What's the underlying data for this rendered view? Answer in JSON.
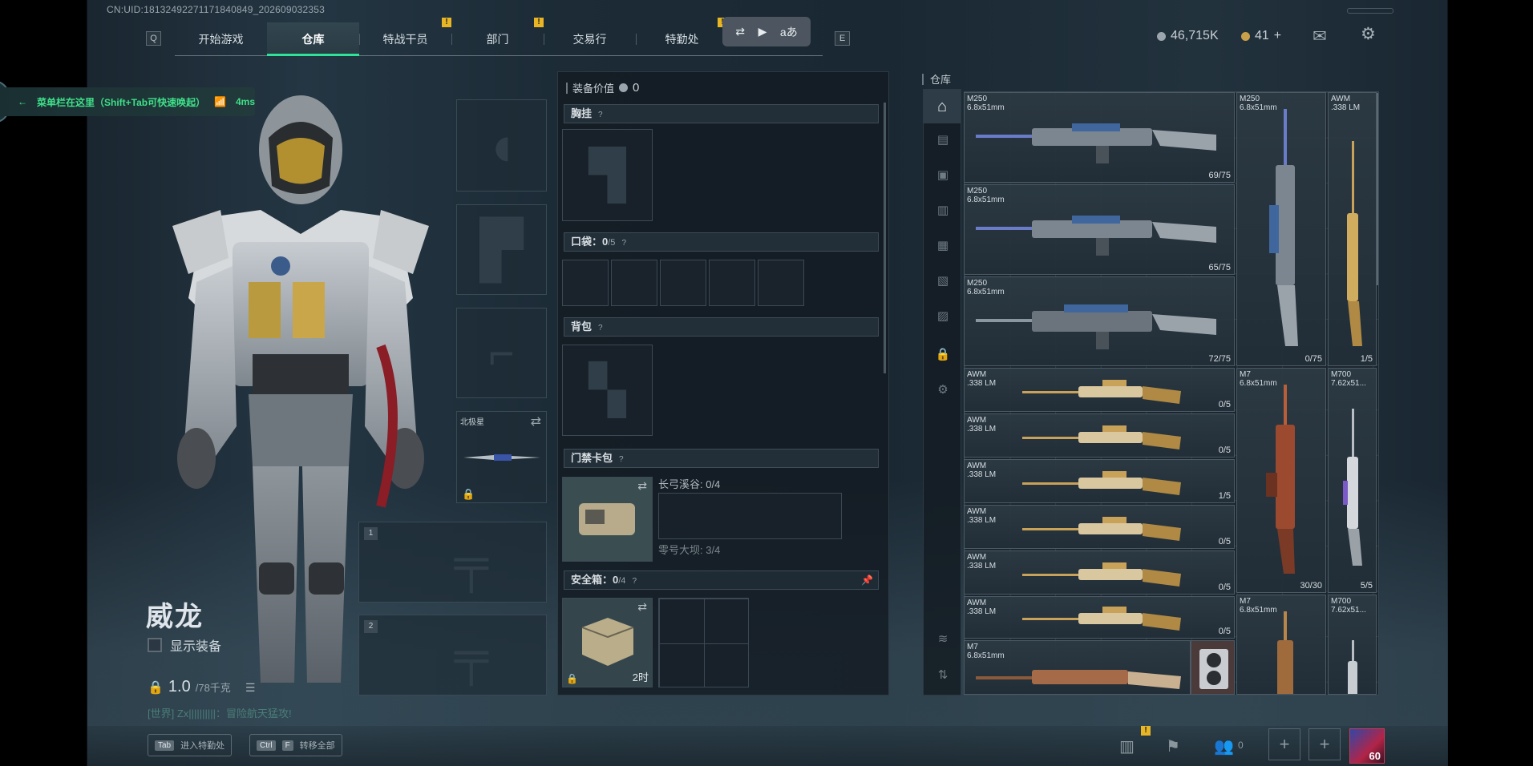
{
  "uid": "CN:UID:1813249227117184084​9_202609032353",
  "nav": {
    "key_left": "Q",
    "key_right": "E",
    "tabs": [
      "开始游戏",
      "仓库",
      "特战干员",
      "部门",
      "交易行",
      "特勤处"
    ],
    "active_tab": "仓库",
    "badge": "!"
  },
  "toolbar": {
    "icons": [
      "screen-switch-icon",
      "video-capture-icon",
      "translate-icon"
    ],
    "translate_label": "aあ"
  },
  "currency": {
    "silver": "46,715K",
    "gold": "41",
    "plus": "+"
  },
  "hint": {
    "text": "菜单栏在这里（Shift+Tab可快速唤起）",
    "ping": "4ms"
  },
  "character": {
    "name": "威龙",
    "show_equipment": "显示装备",
    "weight": "1.0",
    "weight_max": "/78千克",
    "chat": "[世界] Zx||||||||||：冒险航天猛攻!",
    "slot_melee_label": "北极星",
    "slot_numbers": [
      "1",
      "2"
    ]
  },
  "equipment": {
    "value_label": "装备价值",
    "value": "0",
    "chest_rig": "胸挂",
    "pocket_label": "口袋：",
    "pocket_count": "0",
    "pocket_max": "/5",
    "backpack": "背包",
    "keycard_label": "门禁卡包",
    "keycard_line1": "长弓溪谷: 0/4",
    "keycard_line2": "零号大坝: 3/4",
    "safebox_label": "安全箱：",
    "safebox_count": "0",
    "safebox_max": "/4",
    "safebox_timer": "2时",
    "help": "?"
  },
  "stash": {
    "title": "仓库",
    "items": [
      {
        "name": "M250\n6.8x51mm",
        "count": "69/75"
      },
      {
        "name": "M250\n6.8x51mm",
        "count": "65/75"
      },
      {
        "name": "M250\n6.8x51mm",
        "count": "72/75"
      },
      {
        "name": "M250\n6.8x51mm",
        "count": "0/75"
      },
      {
        "name": "AWM\n.338 LM",
        "count": "1/5"
      },
      {
        "name": "AWM\n.338 LM",
        "count": "0/5"
      },
      {
        "name": "AWM\n.338 LM",
        "count": "0/5"
      },
      {
        "name": "AWM\n.338 LM",
        "count": "1/5"
      },
      {
        "name": "AWM\n.338 LM",
        "count": "0/5"
      },
      {
        "name": "AWM\n.338 LM",
        "count": "0/5"
      },
      {
        "name": "AWM\n.338 LM",
        "count": "0/5"
      },
      {
        "name": "M7\n6.8x51mm",
        "count": "30/30"
      },
      {
        "name": "M700\n7.62x51...",
        "count": "5/5"
      },
      {
        "name": "M7\n6.8x51mm",
        "count": ""
      },
      {
        "name": "M7\n6.8x51mm",
        "count": ""
      },
      {
        "name": "M700\n7.62x51...",
        "count": ""
      }
    ]
  },
  "bottom": {
    "tab_key": "Tab",
    "tab_action": "进入特勤处",
    "ctrl_key": "Ctrl",
    "f_key": "F",
    "ctrl_action": "转移全部",
    "friends_count": "0",
    "plus": "+",
    "level": "60"
  },
  "colors": {
    "accent": "#2ee29a",
    "badge": "#e8b624",
    "hint_text": "#3fe08a",
    "gold_weapon": "#c9a25a",
    "copper_weapon": "#b85f3a"
  }
}
